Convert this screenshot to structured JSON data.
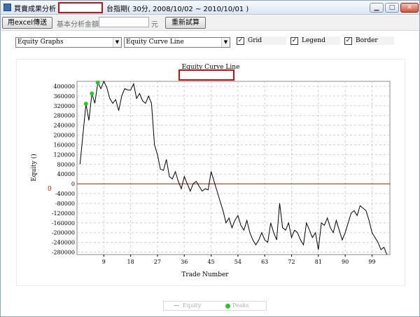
{
  "window": {
    "title_prefix": "買賣成果分析 -",
    "title_suffix": "台指期( 30分, 2008/10/02 ~ 2010/10/01 )",
    "minimize": "▁",
    "maximize": "□",
    "close": "✕"
  },
  "toolbar": {
    "export_excel": "用excel傳送",
    "base_amount_label": "基本分析金額",
    "base_amount_value": "",
    "currency_unit": "元",
    "retest_button": "重新試算"
  },
  "controls": {
    "graph_select": "Equity Graphs",
    "curve_select": "Equity Curve Line",
    "arrow": "▼",
    "grid_label": "Grid",
    "legend_label": "Legend",
    "border_label": "Border",
    "grid_checked": true,
    "legend_checked": true,
    "border_checked": true,
    "checkmark": "✓"
  },
  "legend": {
    "equity_label": "Equity",
    "peaks_label": "Peaks",
    "line_symbol": "—"
  },
  "colors": {
    "line": "#000000",
    "peaks": "#22cc22",
    "zero_line": "#8b2500",
    "zero_label": "#cc2200",
    "grid": "#cfcfcf",
    "highlight": "#cc1111"
  },
  "chart_data": {
    "type": "line",
    "title": "Equity Curve Line",
    "xlabel": "Trade Number",
    "ylabel": "Equity ()",
    "zero_label": "0",
    "xlim": [
      0,
      105
    ],
    "ylim": [
      -290000,
      420000
    ],
    "x_ticks": [
      9,
      18,
      27,
      36,
      45,
      54,
      63,
      72,
      81,
      90,
      99
    ],
    "y_ticks": [
      400000,
      360000,
      320000,
      280000,
      240000,
      200000,
      160000,
      120000,
      80000,
      40000,
      0,
      -40000,
      -80000,
      -120000,
      -160000,
      -200000,
      -240000,
      -280000
    ],
    "grid": true,
    "legend": "bottom",
    "series": [
      {
        "name": "Equity",
        "x": [
          1,
          3,
          4,
          5,
          6,
          7,
          8,
          9,
          10,
          11,
          12,
          13,
          14,
          15,
          16,
          17,
          18,
          19,
          20,
          21,
          22,
          23,
          24,
          25,
          26,
          27,
          28,
          29,
          30,
          31,
          32,
          33,
          34,
          35,
          36,
          37,
          38,
          39,
          40,
          41,
          42,
          43,
          44,
          45,
          46,
          47,
          48,
          49,
          50,
          51,
          52,
          53,
          54,
          55,
          56,
          57,
          58,
          59,
          60,
          61,
          62,
          63,
          64,
          65,
          66,
          67,
          68,
          69,
          70,
          71,
          72,
          73,
          74,
          75,
          76,
          77,
          78,
          79,
          80,
          81,
          82,
          83,
          84,
          85,
          86,
          87,
          88,
          89,
          90,
          91,
          92,
          93,
          94,
          95,
          96,
          97,
          98,
          99,
          100,
          101,
          102,
          103,
          104
        ],
        "y": [
          80000,
          328000,
          260000,
          370000,
          330000,
          415000,
          390000,
          420000,
          395000,
          350000,
          330000,
          345000,
          300000,
          360000,
          390000,
          385000,
          385000,
          410000,
          350000,
          370000,
          340000,
          330000,
          360000,
          330000,
          160000,
          120000,
          60000,
          55000,
          100000,
          30000,
          20000,
          50000,
          10000,
          -20000,
          30000,
          0,
          -30000,
          0,
          10000,
          -10000,
          -30000,
          -20000,
          -25000,
          50000,
          10000,
          -30000,
          -70000,
          -110000,
          -160000,
          -140000,
          -180000,
          -150000,
          -130000,
          -170000,
          -190000,
          -150000,
          -200000,
          -230000,
          -250000,
          -230000,
          -200000,
          -230000,
          -240000,
          -160000,
          -200000,
          -230000,
          -80000,
          -180000,
          -190000,
          -160000,
          -220000,
          -190000,
          -200000,
          -230000,
          -250000,
          -160000,
          -190000,
          -220000,
          -200000,
          -270000,
          -160000,
          -170000,
          -140000,
          -180000,
          -200000,
          -150000,
          -190000,
          -230000,
          -200000,
          -160000,
          -120000,
          -110000,
          -130000,
          -90000,
          -100000,
          -110000,
          -150000,
          -200000,
          -220000,
          -240000,
          -270000,
          -260000,
          -290000
        ]
      },
      {
        "name": "Peaks",
        "x": [
          3,
          5,
          7
        ],
        "y": [
          328000,
          370000,
          415000
        ]
      }
    ]
  }
}
